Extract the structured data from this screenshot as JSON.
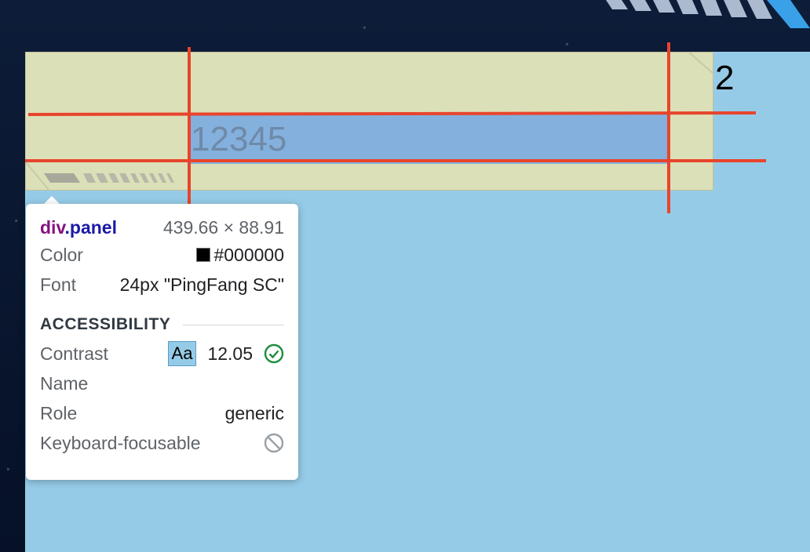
{
  "overlay": {
    "value_text": "12345",
    "corner_label": "2"
  },
  "tooltip": {
    "tag": "div",
    "class_name": ".panel",
    "dimensions": "439.66 × 88.91",
    "rows": [
      {
        "label": "Color",
        "value": "#000000"
      },
      {
        "label": "Font",
        "value": "24px \"PingFang SC\""
      }
    ],
    "accessibility": {
      "heading": "ACCESSIBILITY",
      "contrast_label": "Contrast",
      "contrast_sample": "Aa",
      "contrast_value": "12.05",
      "name_label": "Name",
      "role_label": "Role",
      "role_value": "generic",
      "keyboard_label": "Keyboard-focusable"
    }
  },
  "colors": {
    "content_background": "#96cbe7",
    "panel_overlay": "#e2e2b4",
    "content_box": "#84b0dd",
    "guide_line": "#e8442c",
    "swatch": "#000000",
    "contrast_pass": "#1e8e3e"
  },
  "icons": {
    "contrast_status": "check-circle-icon",
    "keyboard_status": "not-allowed-icon"
  }
}
